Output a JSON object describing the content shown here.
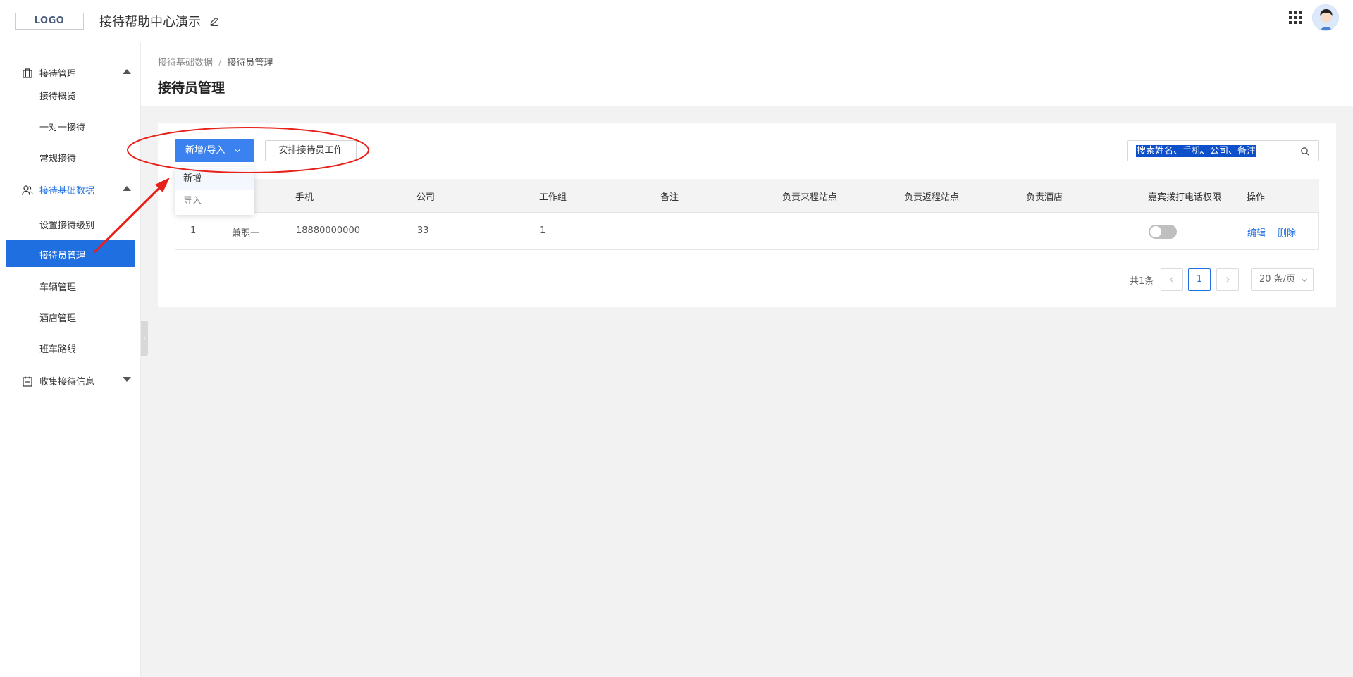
{
  "header": {
    "logo_text": "LOGO",
    "app_title": "接待帮助中心演示",
    "icons": [
      "edit-icon",
      "apps-grid-icon",
      "avatar"
    ]
  },
  "sidebar": {
    "groups": [
      {
        "label": "接待管理",
        "icon": "briefcase-icon",
        "expanded": true,
        "items": [
          "接待概览",
          "一对一接待",
          "常规接待"
        ]
      },
      {
        "label": "接待基础数据",
        "icon": "users-icon",
        "expanded": true,
        "active": true,
        "items": [
          "设置接待级别",
          "接待员管理",
          "车辆管理",
          "酒店管理",
          "班车路线"
        ]
      },
      {
        "label": "收集接待信息",
        "icon": "clipboard-icon",
        "expanded": false,
        "items": []
      }
    ],
    "selected_item": "接待员管理"
  },
  "breadcrumb": {
    "parent": "接待基础数据",
    "separator": "/",
    "current": "接待员管理"
  },
  "page_title": "接待员管理",
  "toolbar": {
    "add_import_label": "新增/导入",
    "arrange_label": "安排接待员工作",
    "dropdown_items": [
      "新增",
      "导入"
    ],
    "search_placeholder": "搜索姓名、手机、公司、备注"
  },
  "table": {
    "columns": [
      "手机",
      "公司",
      "工作组",
      "备注",
      "负责来程站点",
      "负责返程站点",
      "负责酒店",
      "嘉宾拨打电话权限",
      "操作"
    ],
    "rows": [
      {
        "index": "1",
        "name": "兼职一",
        "phone": "18880000000",
        "company": "33",
        "group": "1",
        "note": "",
        "arrival_site": "",
        "return_site": "",
        "hotel": "",
        "call_permission": false,
        "actions": [
          "编辑",
          "删除"
        ]
      }
    ]
  },
  "pagination": {
    "total": "共1条",
    "current_page": "1",
    "page_size": "20 条/页"
  },
  "colors": {
    "primary": "#1f6fe0",
    "button": "#3b82f0",
    "annotation": "#e8201a"
  }
}
